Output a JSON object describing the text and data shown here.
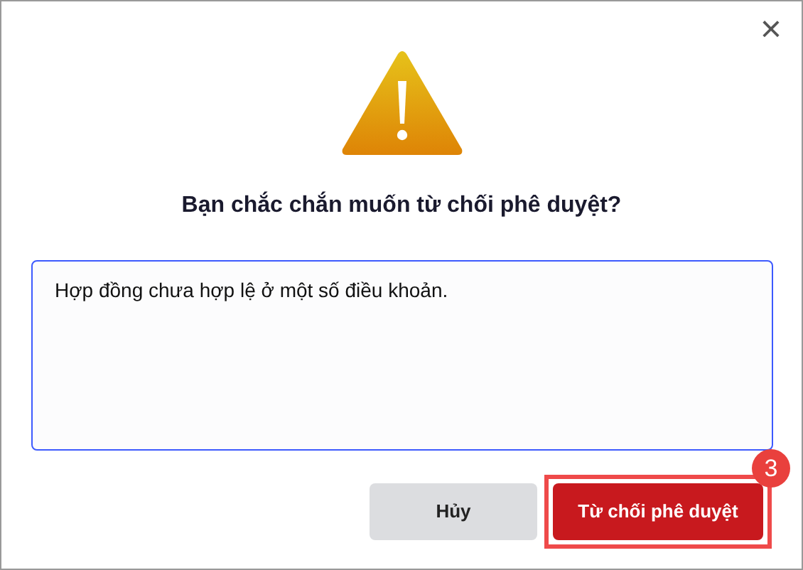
{
  "dialog": {
    "close": "×",
    "title": "Bạn chắc chắn muốn từ chối phê duyệt?",
    "reason": {
      "value": "Hợp đồng chưa hợp lệ ở một số điều khoản.",
      "focused": true
    },
    "buttons": [
      {
        "label": "Hủy",
        "kind": "cancel"
      },
      {
        "label": "Từ chối phê duyệt",
        "kind": "danger",
        "step_badge": "3"
      }
    ]
  }
}
